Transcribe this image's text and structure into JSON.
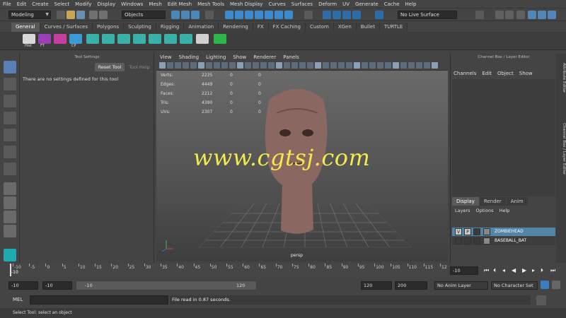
{
  "menu": [
    "File",
    "Edit",
    "Create",
    "Select",
    "Modify",
    "Display",
    "Windows",
    "Mesh",
    "Edit Mesh",
    "Mesh Tools",
    "Mesh Display",
    "Curves",
    "Surfaces",
    "Deform",
    "UV",
    "Generate",
    "Cache",
    "Help"
  ],
  "status_line": {
    "mode": "Modeling",
    "selection_mode": "Objects",
    "live_surface": "No Live Surface"
  },
  "shelf_tabs": [
    "General",
    "Curves / Surfaces",
    "Polygons",
    "Sculpting",
    "Rigging",
    "Animation",
    "Rendering",
    "FX",
    "FX Caching",
    "Custom",
    "XGen",
    "Bullet",
    "TURTLE"
  ],
  "shelf_active": "General",
  "shelf_icons": [
    {
      "label": "Hist",
      "color": "#d9d9d9"
    },
    {
      "label": "FT",
      "color": "#9b3fb5"
    },
    {
      "label": "",
      "color": "#c43fa0"
    },
    {
      "label": "CP",
      "color": "#3c9bd6"
    },
    {
      "label": "",
      "color": "#39b1a8"
    },
    {
      "label": "",
      "color": "#39b1a8"
    },
    {
      "label": "",
      "color": "#39b1a8"
    },
    {
      "label": "",
      "color": "#39b1a8"
    },
    {
      "label": "",
      "color": "#39b1a8"
    },
    {
      "label": "",
      "color": "#39b1a8"
    },
    {
      "label": "",
      "color": "#39b1a8"
    },
    {
      "label": "",
      "color": "#d0d0d0"
    },
    {
      "label": "",
      "color": "#2fb54a"
    }
  ],
  "tool_settings": {
    "title": "Tool Settings",
    "reset_button": "Reset Tool",
    "help_button": "Tool Help",
    "message": "There are no settings defined for this tool"
  },
  "viewport": {
    "menu": [
      "View",
      "Shading",
      "Lighting",
      "Show",
      "Renderer",
      "Panels"
    ],
    "hud": [
      {
        "label": "Verts:",
        "values": [
          "2235",
          "0",
          "0"
        ]
      },
      {
        "label": "Edges:",
        "values": [
          "4449",
          "0",
          "0"
        ]
      },
      {
        "label": "Faces:",
        "values": [
          "2212",
          "0",
          "0"
        ]
      },
      {
        "label": "Tris:",
        "values": [
          "4390",
          "0",
          "0"
        ]
      },
      {
        "label": "UVs:",
        "values": [
          "2307",
          "0",
          "0"
        ]
      }
    ],
    "camera": "persp",
    "watermark": "www.cgtsj.com"
  },
  "channel_box": {
    "title": "Channel Box / Layer Editor",
    "menu": [
      "Channels",
      "Edit",
      "Object",
      "Show"
    ],
    "tabs": [
      "Display",
      "Render",
      "Anim"
    ],
    "active_tab": "Display",
    "layer_menu": [
      "Layers",
      "Options",
      "Help"
    ],
    "layers": [
      {
        "v": "V",
        "p": "P",
        "name": "ZOMBIEHEAD",
        "selected": true
      },
      {
        "v": "",
        "p": "",
        "name": "BASEBALL_BAT",
        "selected": false
      }
    ]
  },
  "side_tabs": [
    "Attribute Editor",
    "Channel Box / Layer Editor"
  ],
  "time_slider": {
    "ticks": [
      "-10",
      "-5",
      "0",
      "5",
      "10",
      "15",
      "20",
      "25",
      "30",
      "35",
      "40",
      "45",
      "50",
      "55",
      "60",
      "65",
      "70",
      "75",
      "80",
      "85",
      "90",
      "95",
      "100",
      "105",
      "110",
      "115",
      "12"
    ],
    "current_frame": "-10",
    "current_frame_field": "-10"
  },
  "range": {
    "start": "-10",
    "anim_start": "-10",
    "slider_min": "-10",
    "slider_max": "120",
    "anim_end": "120",
    "end": "200",
    "anim_layer": "No Anim Layer",
    "character_set": "No Character Set"
  },
  "command": {
    "label": "MEL",
    "result": "File read in  0.87 seconds."
  },
  "help_line": "Select Tool: select an object"
}
